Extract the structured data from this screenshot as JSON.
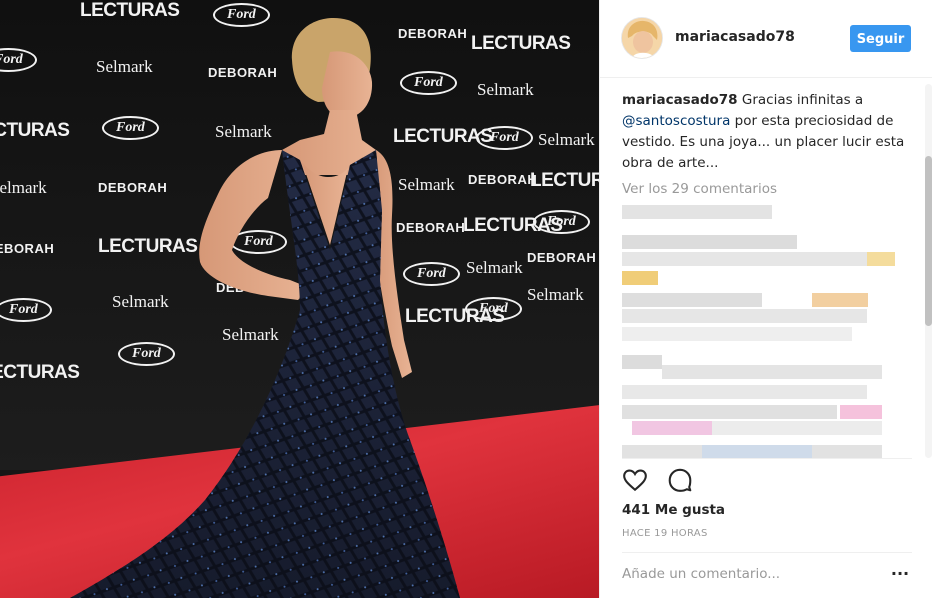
{
  "post": {
    "username": "mariacasado78",
    "follow_label": "Seguir",
    "caption": {
      "user": "mariacasado78",
      "text_before": "Gracias infinitas a",
      "mention": "@santoscostura",
      "text_after": "por esta preciosidad de vestido. Es una joya... un placer lucir esta obra de arte..."
    },
    "view_all_comments": "Ver los 29 comentarios",
    "likes": "441 Me gusta",
    "time": "HACE 19 HORAS",
    "comment_placeholder": "Añade un comentario..."
  },
  "photo": {
    "backdrop_logos": [
      "LECTURAS",
      "Ford",
      "DEBORAH",
      "Selmark"
    ],
    "carpet_color": "#d92c36",
    "dress_color": "#1c2237"
  },
  "colors": {
    "accent": "#3897f0",
    "mention": "#003569",
    "muted": "#999999",
    "text": "#262626"
  },
  "icons": [
    "heart-icon",
    "comment-icon",
    "more-options-icon"
  ]
}
